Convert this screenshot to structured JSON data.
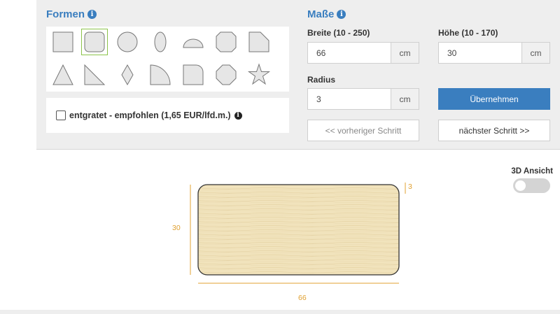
{
  "shapes": {
    "title": "Formen",
    "info_icon": "info-icon",
    "items": [
      {
        "name": "rectangle"
      },
      {
        "name": "rounded-rectangle",
        "selected": true
      },
      {
        "name": "circle"
      },
      {
        "name": "ellipse"
      },
      {
        "name": "semicircle"
      },
      {
        "name": "octagon-rectangle"
      },
      {
        "name": "trapezoid-slanted"
      },
      {
        "name": "triangle"
      },
      {
        "name": "right-triangle"
      },
      {
        "name": "diamond"
      },
      {
        "name": "quarter-circle"
      },
      {
        "name": "rounded-corner-rectangle"
      },
      {
        "name": "octagon"
      },
      {
        "name": "star"
      }
    ]
  },
  "edging": {
    "checked": false,
    "label": "entgratet - empfohlen (1,65 EUR/lfd.m.)",
    "info_icon": "info-icon"
  },
  "dimensions": {
    "title": "Maße",
    "info_icon": "info-icon",
    "width_label": "Breite (10 - 250)",
    "width_value": "66",
    "height_label": "Höhe (10 - 170)",
    "height_value": "30",
    "radius_label": "Radius",
    "radius_value": "3",
    "unit": "cm",
    "apply_button": "Übernehmen",
    "prev_button": "<< vorheriger Schritt",
    "next_button": "nächster Schritt >>"
  },
  "view3d": {
    "label": "3D Ansicht",
    "enabled": false
  },
  "preview": {
    "width_label": "66",
    "height_label": "30",
    "radius_label": "3",
    "accent_color": "#e0a030",
    "material_color": "#f1e3bc"
  }
}
